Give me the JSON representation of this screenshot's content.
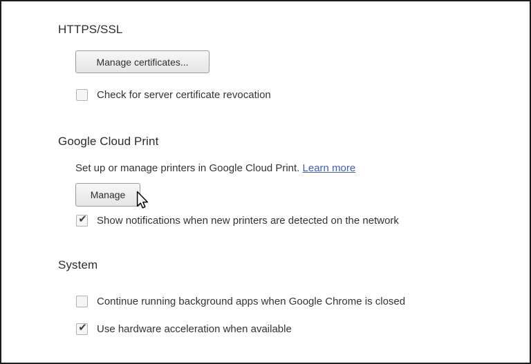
{
  "colors": {
    "page_background": "#ffffff",
    "frame_border": "#1d1d1d",
    "heading_text": "#2c2c2c",
    "body_text": "#333333",
    "link": "#3c5ccc",
    "button_border": "#9a9a9a",
    "button_background_top": "#f7f7f7",
    "button_background_bottom": "#e5e5e5",
    "checkbox_border": "#b2b2b2",
    "checkbox_background": "#f5f5f5",
    "checkmark": "#3d3d3d"
  },
  "sections": {
    "https_ssl": {
      "title": "HTTPS/SSL",
      "manage_certificates_button_label": "Manage certificates...",
      "check_revocation": {
        "label": "Check for server certificate revocation",
        "checked": false,
        "glyph": ""
      }
    },
    "google_cloud_print": {
      "title": "Google Cloud Print",
      "description": "Set up or manage printers in Google Cloud Print.",
      "learn_more_label": "Learn more",
      "manage_button_label": "Manage",
      "show_notifications": {
        "label": "Show notifications when new printers are detected on the network",
        "checked": true,
        "glyph": "✔"
      }
    },
    "system": {
      "title": "System",
      "background_apps": {
        "label": "Continue running background apps when Google Chrome is closed",
        "checked": false,
        "glyph": ""
      },
      "hardware_acceleration": {
        "label": "Use hardware acceleration when available",
        "checked": true,
        "glyph": "✔"
      }
    }
  },
  "cursor": {
    "icon": "arrow-cursor"
  }
}
